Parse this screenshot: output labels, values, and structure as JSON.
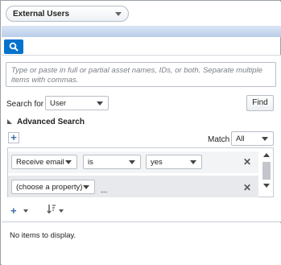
{
  "collection_select": {
    "value": "External Users"
  },
  "search": {
    "placeholder": "Type or paste in full or partial asset names, IDs, or both. Separate multiple items with commas.",
    "search_for_label": "Search for",
    "search_for_value": "User",
    "find_label": "Find"
  },
  "advanced": {
    "header": "Advanced Search",
    "match_label": "Match",
    "match_value": "All",
    "rows": [
      {
        "property": "Receive email",
        "operator": "is",
        "value": "yes"
      },
      {
        "property": "(choose a property)",
        "extra": "..."
      }
    ]
  },
  "results": {
    "empty_message": "No items to display."
  },
  "icons": {
    "search": "search-icon",
    "add": "plus-icon",
    "sort": "sort-icon",
    "remove": "close-icon",
    "collapse": "triangle-down-icon"
  },
  "colors": {
    "accent": "#0572ce",
    "band": "#c7d8ef"
  }
}
